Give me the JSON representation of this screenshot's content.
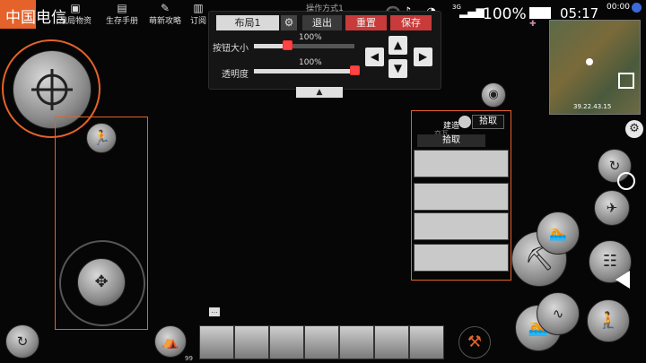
{
  "status_bar": {
    "carrier": "中国电信",
    "battery": "100%",
    "time": "05:17",
    "speed_net": "3G",
    "data_speed": "00:00"
  },
  "top_tabs": [
    {
      "label": "战局物资",
      "icon": "box-icon"
    },
    {
      "label": "生存手册",
      "icon": "book-icon"
    },
    {
      "label": "萌新攻略",
      "icon": "guide-icon"
    },
    {
      "label": "订阅",
      "icon": "subscribe-icon"
    }
  ],
  "edit_panel": {
    "title": "操作方式1",
    "layout_button": "布局1",
    "exit_button": "退出",
    "reset_button": "重置",
    "save_button": "保存",
    "button_size_label": "按钮大小",
    "button_size_value": "100%",
    "opacity_label": "透明度",
    "opacity_value": "100%",
    "button_size_fraction": 0.35,
    "opacity_fraction": 1.0
  },
  "pickup_panel": {
    "header_label": "建造",
    "pickup_label": "拾取",
    "list_pickup_label": "拾取",
    "list_partial_label": "交互"
  },
  "minimap": {
    "coords": "39.22.43.15"
  },
  "hotbar": {
    "count_label": "99",
    "slots": 7
  },
  "colors": {
    "accent": "#e5622a",
    "red": "#d84040"
  }
}
